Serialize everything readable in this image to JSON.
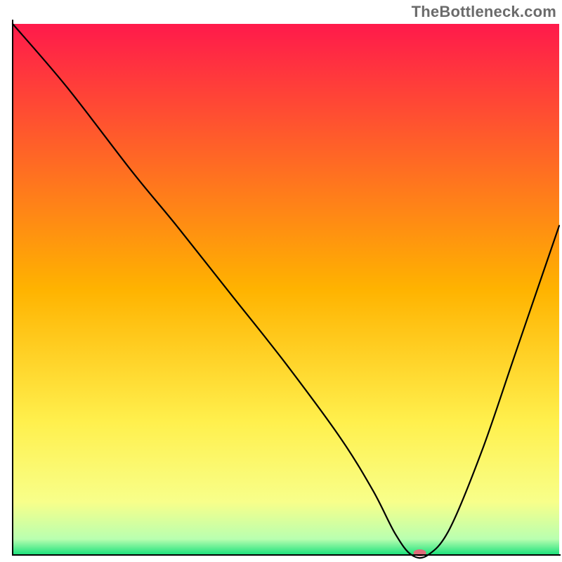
{
  "watermark": {
    "text": "TheBottleneck.com"
  },
  "chart_data": {
    "type": "line",
    "title": "",
    "xlabel": "",
    "ylabel": "",
    "xlim": [
      0,
      100
    ],
    "ylim": [
      0,
      100
    ],
    "grid": false,
    "legend": "none",
    "background": {
      "gradient": [
        {
          "pos": 0.0,
          "color": "#ff1a4b"
        },
        {
          "pos": 0.5,
          "color": "#ffb300"
        },
        {
          "pos": 0.75,
          "color": "#fff04d"
        },
        {
          "pos": 0.9,
          "color": "#f8ff8a"
        },
        {
          "pos": 0.97,
          "color": "#b9ffb0"
        },
        {
          "pos": 1.0,
          "color": "#18e07a"
        }
      ]
    },
    "series": [
      {
        "name": "bottleneck-curve",
        "x": [
          0,
          10,
          22,
          30,
          40,
          50,
          60,
          66,
          70,
          73,
          76,
          80,
          86,
          92,
          100
        ],
        "y": [
          100,
          88,
          72,
          62,
          49,
          36,
          22,
          12,
          4,
          0,
          0,
          5,
          20,
          38,
          62
        ]
      }
    ],
    "marker": {
      "name": "optimal-point",
      "x": 74.5,
      "y": 0,
      "color": "#e06b7a",
      "rx": 9,
      "ry": 5
    },
    "axes": {
      "color": "#000000",
      "width": 2
    }
  }
}
